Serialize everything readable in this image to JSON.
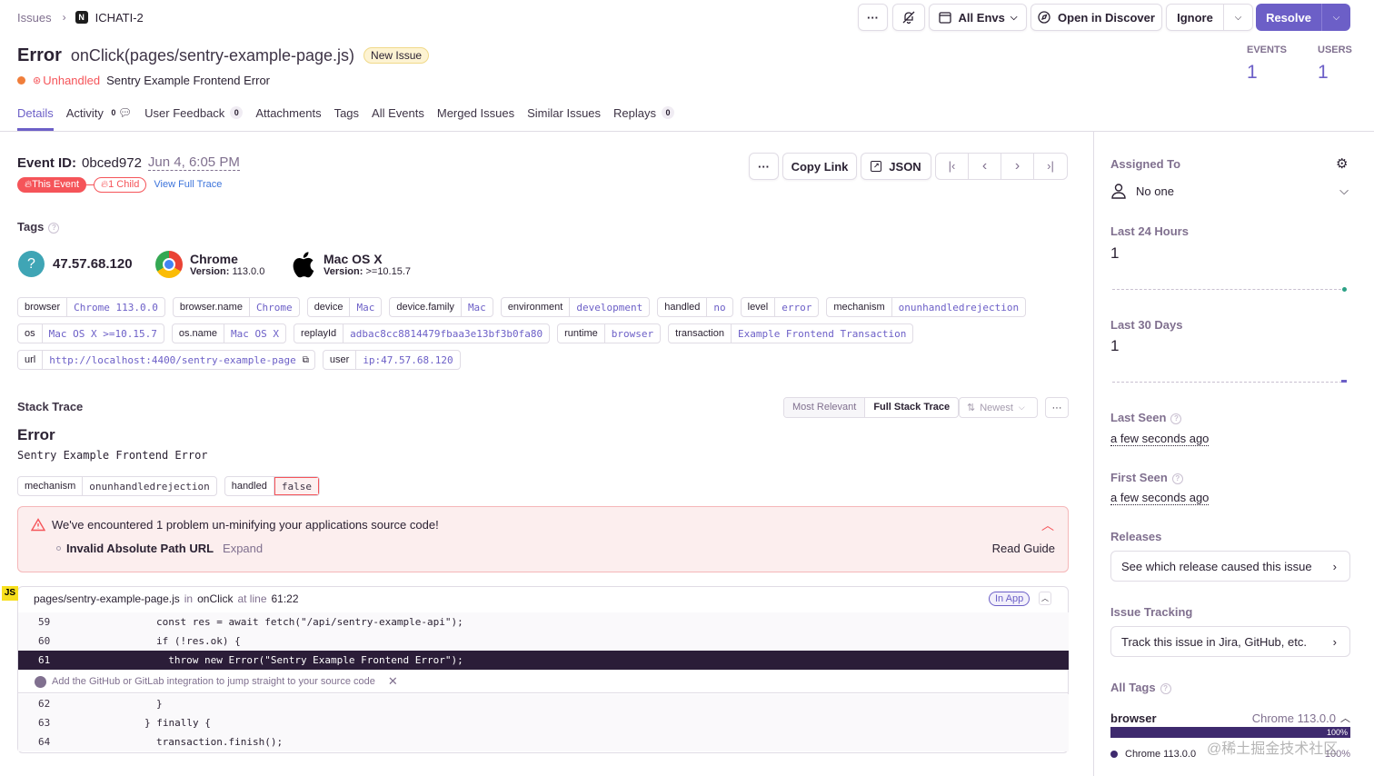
{
  "breadcrumb": {
    "parent": "Issues",
    "current": "ICHATI-2"
  },
  "header_actions": {
    "more": "···",
    "envs": "All Envs",
    "discover": "Open in Discover",
    "ignore": "Ignore",
    "resolve": "Resolve"
  },
  "issue": {
    "type": "Error",
    "culprit": "onClick(pages/sentry-example-page.js)",
    "badge": "New Issue",
    "unhandled": "Unhandled",
    "message": "Sentry Example Frontend Error"
  },
  "stats": {
    "events_label": "EVENTS",
    "events": "1",
    "users_label": "USERS",
    "users": "1"
  },
  "tabs": [
    {
      "label": "Details"
    },
    {
      "label": "Activity",
      "count": "0"
    },
    {
      "label": "User Feedback",
      "count": "0"
    },
    {
      "label": "Attachments"
    },
    {
      "label": "Tags"
    },
    {
      "label": "All Events"
    },
    {
      "label": "Merged Issues"
    },
    {
      "label": "Similar Issues"
    },
    {
      "label": "Replays",
      "count": "0"
    }
  ],
  "event": {
    "label": "Event ID:",
    "id": "0bced972",
    "time": "Jun 4, 6:05 PM",
    "this_event": "This Event",
    "child": "1 Child",
    "trace": "View Full Trace",
    "copy_link": "Copy Link",
    "json": "JSON",
    "more": "···"
  },
  "tags_section": {
    "title": "Tags",
    "highlights": [
      {
        "title": "47.57.68.120"
      },
      {
        "title": "Chrome",
        "version_label": "Version:",
        "version": "113.0.0"
      },
      {
        "title": "Mac OS X",
        "version_label": "Version:",
        "version": ">=10.15.7"
      }
    ],
    "rows": [
      [
        {
          "k": "browser",
          "v": "Chrome 113.0.0"
        },
        {
          "k": "browser.name",
          "v": "Chrome"
        },
        {
          "k": "device",
          "v": "Mac"
        },
        {
          "k": "device.family",
          "v": "Mac"
        },
        {
          "k": "environment",
          "v": "development"
        },
        {
          "k": "handled",
          "v": "no"
        },
        {
          "k": "level",
          "v": "error"
        },
        {
          "k": "mechanism",
          "v": "onunhandledrejection"
        }
      ],
      [
        {
          "k": "os",
          "v": "Mac OS X >=10.15.7"
        },
        {
          "k": "os.name",
          "v": "Mac OS X"
        },
        {
          "k": "replayId",
          "v": "adbac8cc8814479fbaa3e13bf3b0fa80"
        },
        {
          "k": "runtime",
          "v": "browser"
        },
        {
          "k": "transaction",
          "v": "Example Frontend Transaction"
        }
      ],
      [
        {
          "k": "url",
          "v": "http://localhost:4400/sentry-example-page"
        },
        {
          "k": "user",
          "v": "ip:47.57.68.120"
        }
      ]
    ]
  },
  "stack": {
    "title": "Stack Trace",
    "most_relevant": "Most Relevant",
    "full": "Full Stack Trace",
    "sort": "Newest",
    "more": "···",
    "error_type": "Error",
    "error_value": "Sentry Example Frontend Error",
    "mech_k": "mechanism",
    "mech_v": "onunhandledrejection",
    "handled_k": "handled",
    "handled_v": "false",
    "alert": {
      "text": "We've encountered 1 problem un-minifying your applications source code!",
      "item": "Invalid Absolute Path URL",
      "expand": "Expand",
      "guide": "Read Guide"
    },
    "frame": {
      "lang": "JS",
      "file": "pages/sentry-example-page.js",
      "in": "in",
      "func": "onClick",
      "at": "at line",
      "line": "61:22",
      "in_app": "In App"
    },
    "lines": [
      {
        "no": "59",
        "code": "const res = await fetch(\"/api/sentry-example-api\");"
      },
      {
        "no": "60",
        "code": "if (!res.ok) {"
      },
      {
        "no": "61",
        "code": "  throw new Error(\"Sentry Example Frontend Error\");"
      },
      {
        "no": "62",
        "code": "}"
      },
      {
        "no": "63",
        "code": "} finally {"
      },
      {
        "no": "64",
        "code": "transaction.finish();"
      }
    ],
    "integration": "Add the GitHub or GitLab integration to jump straight to your source code"
  },
  "sidebar": {
    "assigned_label": "Assigned To",
    "assigned_value": "No one",
    "last24_label": "Last 24 Hours",
    "last24_value": "1",
    "last30_label": "Last 30 Days",
    "last30_value": "1",
    "last_seen_label": "Last Seen",
    "last_seen_value": "a few seconds ago",
    "first_seen_label": "First Seen",
    "first_seen_value": "a few seconds ago",
    "releases_label": "Releases",
    "releases_value": "See which release caused this issue",
    "tracking_label": "Issue Tracking",
    "tracking_value": "Track this issue in Jira, GitHub, etc.",
    "all_tags_label": "All Tags",
    "tag_name": "browser",
    "tag_top": "Chrome 113.0.0",
    "tag_pct": "100%",
    "tag_legend": "Chrome 113.0.0",
    "tag_legend_pct": "100%",
    "tag_share": 1.0
  },
  "watermark": "@稀土掘金技术社区",
  "colors": {
    "accent": "#6c5fc7",
    "resolve": "#6c5fc7",
    "error": "#f55459",
    "highlight_row": "#2b1d38"
  }
}
